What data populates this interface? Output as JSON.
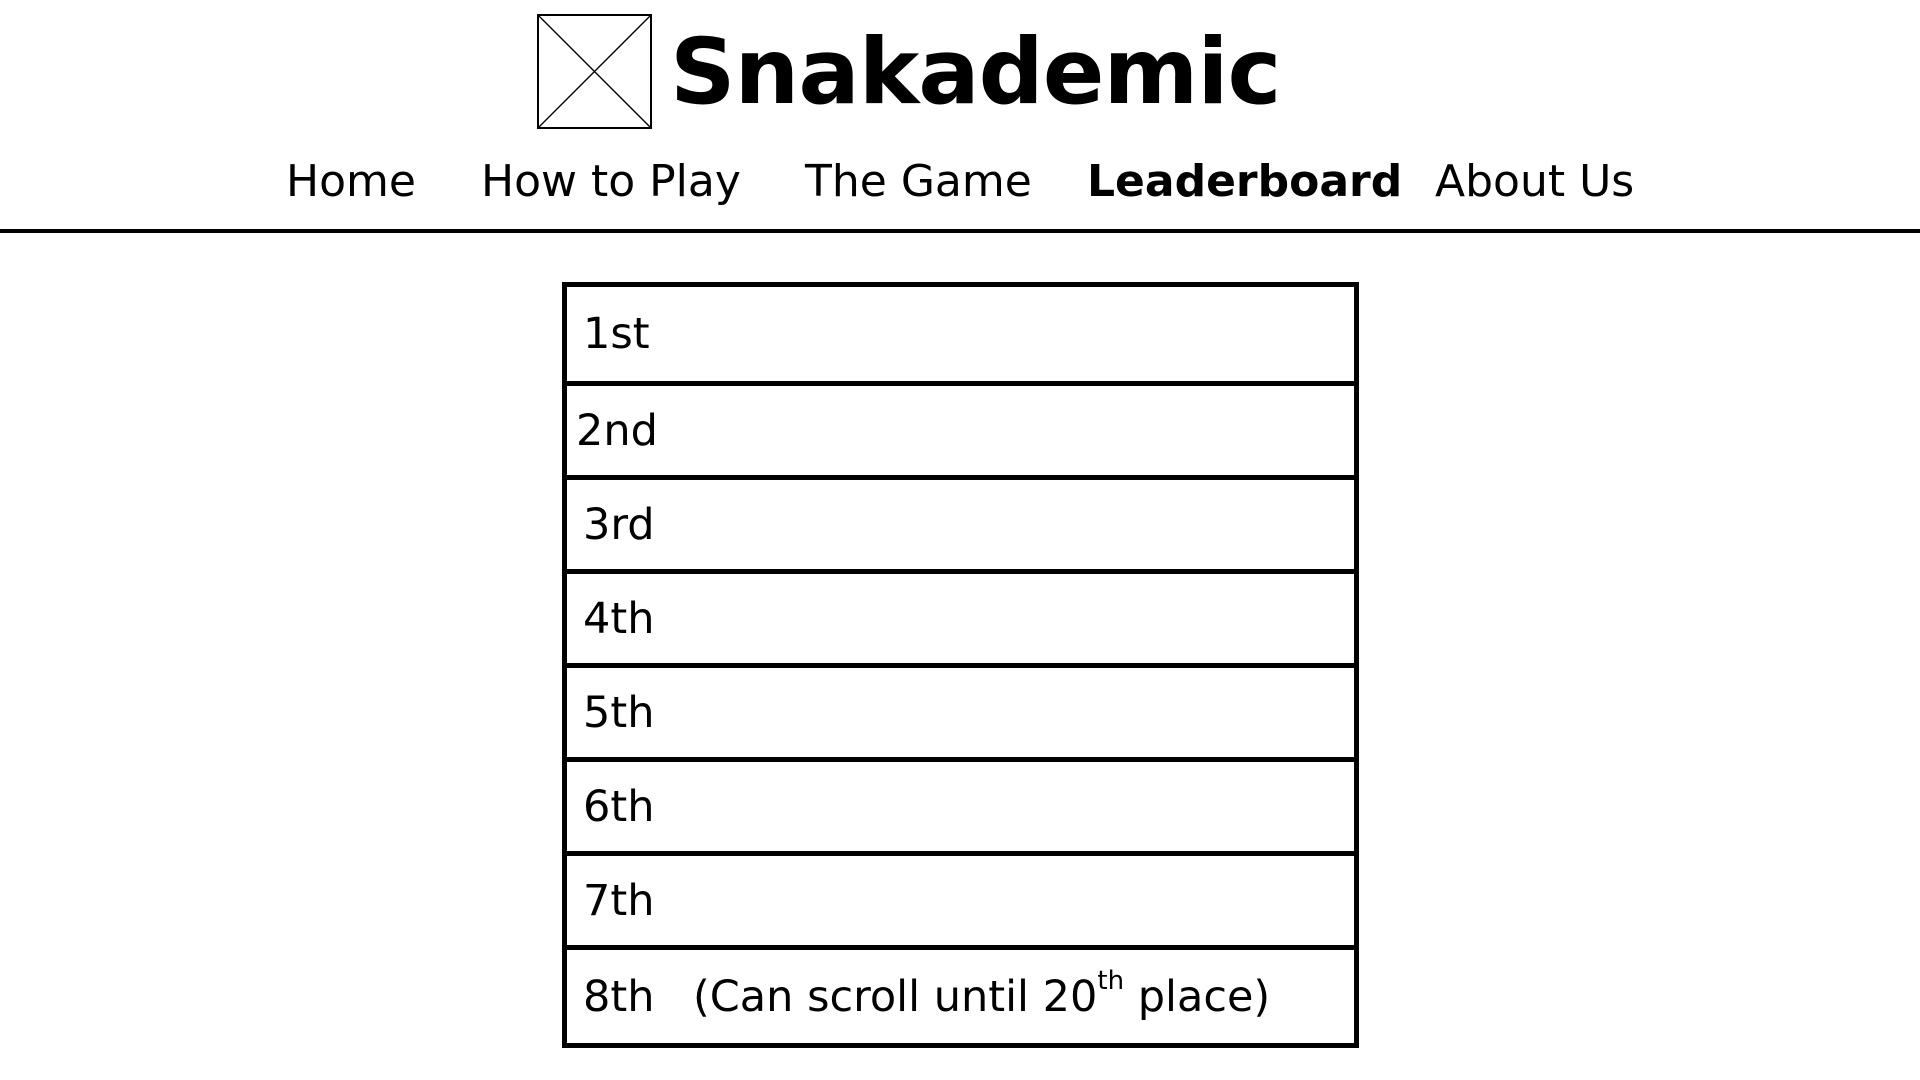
{
  "header": {
    "logo_icon": "image-placeholder-icon",
    "title": "Snakademic"
  },
  "nav": {
    "items": [
      {
        "label": "Home",
        "active": false
      },
      {
        "label": "How to Play",
        "active": false
      },
      {
        "label": "The Game",
        "active": false
      },
      {
        "label": "Leaderboard",
        "active": true
      },
      {
        "label": "About Us",
        "active": false
      }
    ]
  },
  "leaderboard": {
    "rows": [
      {
        "rank": "1st"
      },
      {
        "rank": "2nd"
      },
      {
        "rank": "3rd"
      },
      {
        "rank": "4th"
      },
      {
        "rank": "5th"
      },
      {
        "rank": "6th"
      },
      {
        "rank": "7th"
      },
      {
        "rank": "8th"
      }
    ],
    "scroll_note": {
      "prefix": "(Can scroll until 20",
      "superscript": "th",
      "suffix": " place)"
    }
  }
}
